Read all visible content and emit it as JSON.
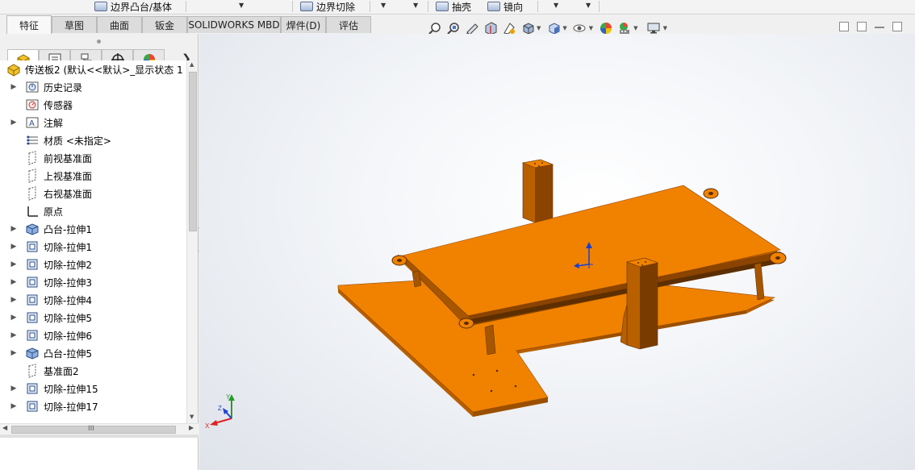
{
  "ribbon": {
    "buttons": [
      {
        "label": "边界凸台/基体"
      },
      {
        "label": "边界切除"
      },
      {
        "label": "抽壳"
      },
      {
        "label": "镜向"
      }
    ]
  },
  "command_tabs": [
    "特征",
    "草图",
    "曲面",
    "钣金",
    "SOLIDWORKS MBD",
    "焊件(D)",
    "评估"
  ],
  "active_tab": "特征",
  "hud_icons": [
    "zoom-to-fit-icon",
    "zoom-area-icon",
    "previous-view-icon",
    "section-view-icon",
    "dynamic-annotation-icon",
    "view-orientation-icon",
    "display-style-icon",
    "hide-show-icon",
    "edit-appearance-icon",
    "scene-icon",
    "view-settings-icon"
  ],
  "tree": {
    "root": "传送板2  (默认<<默认>_显示状态 1",
    "items": [
      {
        "label": "历史记录",
        "icon": "history-icon",
        "expandable": true
      },
      {
        "label": "传感器",
        "icon": "sensor-icon",
        "expandable": false
      },
      {
        "label": "注解",
        "icon": "annotation-icon",
        "expandable": true
      },
      {
        "label": "材质 <未指定>",
        "icon": "material-icon",
        "expandable": false
      },
      {
        "label": "前视基准面",
        "icon": "plane-icon",
        "expandable": false
      },
      {
        "label": "上视基准面",
        "icon": "plane-icon",
        "expandable": false
      },
      {
        "label": "右视基准面",
        "icon": "plane-icon",
        "expandable": false
      },
      {
        "label": "原点",
        "icon": "origin-icon",
        "expandable": false
      },
      {
        "label": "凸台-拉伸1",
        "icon": "boss-extrude-icon",
        "expandable": true
      },
      {
        "label": "切除-拉伸1",
        "icon": "cut-extrude-icon",
        "expandable": true
      },
      {
        "label": "切除-拉伸2",
        "icon": "cut-extrude-icon",
        "expandable": true
      },
      {
        "label": "切除-拉伸3",
        "icon": "cut-extrude-icon",
        "expandable": true
      },
      {
        "label": "切除-拉伸4",
        "icon": "cut-extrude-icon",
        "expandable": true
      },
      {
        "label": "切除-拉伸5",
        "icon": "cut-extrude-icon",
        "expandable": true
      },
      {
        "label": "切除-拉伸6",
        "icon": "cut-extrude-icon",
        "expandable": true
      },
      {
        "label": "凸台-拉伸5",
        "icon": "boss-extrude-icon",
        "expandable": true
      },
      {
        "label": "基准面2",
        "icon": "plane-icon",
        "expandable": false
      },
      {
        "label": "切除-拉伸15",
        "icon": "cut-extrude-icon",
        "expandable": true
      },
      {
        "label": "切除-拉伸17",
        "icon": "cut-extrude-icon",
        "expandable": true
      }
    ]
  },
  "hscroll_label": "III",
  "triad": {
    "x": "X",
    "y": "Y",
    "z": "Z"
  },
  "colors": {
    "model": "#f08200",
    "model_dark": "#8a4300",
    "model_side": "#b85f00"
  }
}
